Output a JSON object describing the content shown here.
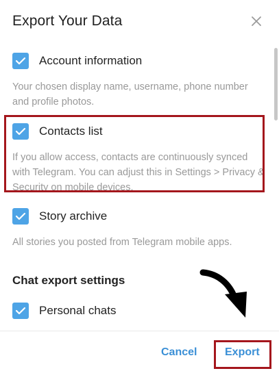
{
  "dialog": {
    "title": "Export Your Data",
    "close_icon": "close-icon"
  },
  "options": [
    {
      "label": "Account information",
      "description": "Your chosen display name, username, phone number and profile photos.",
      "checked": true
    },
    {
      "label": "Contacts list",
      "description": "If you allow access, contacts are continuously synced with Telegram. You can adjust this in Settings > Privacy & Security on mobile devices.",
      "checked": true
    },
    {
      "label": "Story archive",
      "description": "All stories you posted from Telegram mobile apps.",
      "checked": true
    }
  ],
  "chat_settings": {
    "section_title": "Chat export settings",
    "items": [
      {
        "label": "Personal chats",
        "checked": true
      }
    ]
  },
  "footer": {
    "cancel_label": "Cancel",
    "export_label": "Export"
  },
  "colors": {
    "accent": "#4ea4e6",
    "button_text": "#3a8fd6",
    "highlight": "#a4161c"
  }
}
